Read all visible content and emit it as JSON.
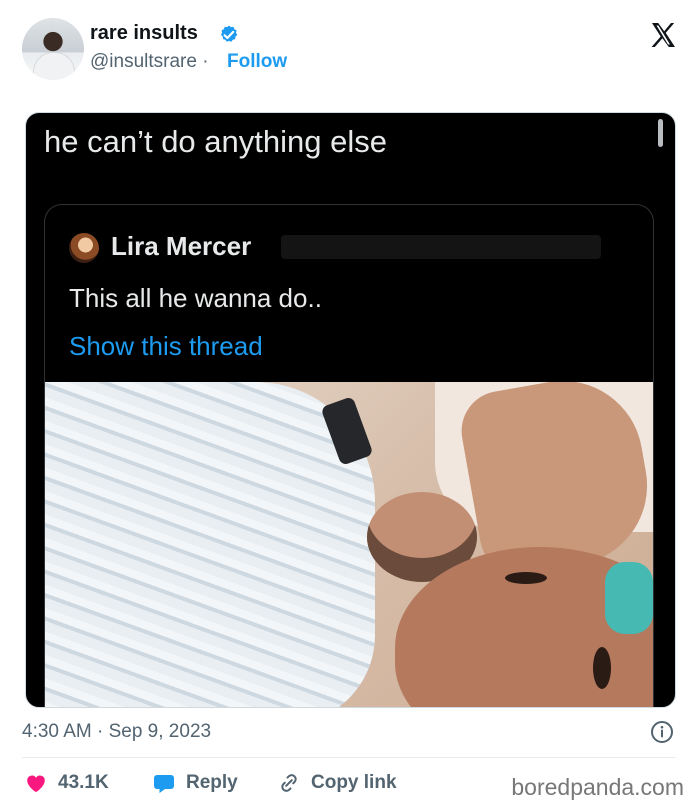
{
  "post": {
    "author": {
      "name": "rare insults",
      "handle": "@insultsrare",
      "separator": "·",
      "follow_label": "Follow"
    },
    "media": {
      "caption": "he can’t do anything else",
      "quoted_post": {
        "author_name": "Lira Mercer",
        "text": "This all he wanna do..",
        "link_label": "Show this thread"
      }
    },
    "timestamp": "4:30 AM · Sep 9, 2023",
    "actions": {
      "likes": "43.1K",
      "reply_label": "Reply",
      "copy_label": "Copy link"
    },
    "colors": {
      "link_blue": "#1d9bf0",
      "like_pink": "#f91880",
      "muted_text": "#536471"
    }
  },
  "watermark": "boredpanda.com",
  "icons": {
    "verified": "verified-badge-icon",
    "platform": "x-logo-icon",
    "info": "info-icon",
    "like": "heart-icon",
    "reply": "speech-bubble-icon",
    "copy": "link-icon"
  }
}
